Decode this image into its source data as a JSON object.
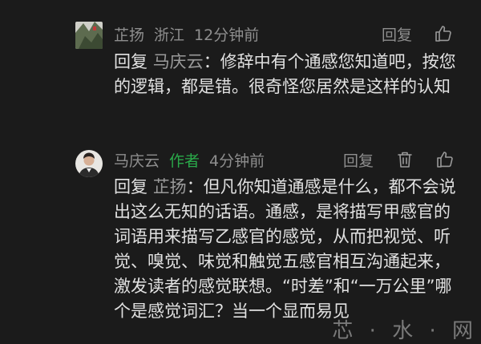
{
  "comments": [
    {
      "username": "芷扬",
      "location": "浙江",
      "time": "12分钟前",
      "reply_label": "回复",
      "text": {
        "prefix": "回复",
        "target": "马庆云",
        "content": "：修辞中有个通感您知道吧，按您的逻辑，都是错。很奇怪您居然是这样的认知"
      }
    },
    {
      "username": "马庆云",
      "author_tag": "作者",
      "time": "4分钟前",
      "reply_label": "回复",
      "text": {
        "prefix": "回复",
        "target": "芷扬",
        "content": "：但凡你知道通感是什么，都不会说出这么无知的话语。通感，是将描写甲感官的词语用来描写乙感官的感觉，从而把视觉、听觉、嗅觉、味觉和触觉五感官相互沟通起来，激发读者的感觉联想。“时差”和“一万公里”哪个是感觉词汇？当一个显而易见"
      }
    }
  ],
  "watermark": "芯 · 水 · 网",
  "colors": {
    "background": "#1b1b1b",
    "meta_text": "#8e8e8e",
    "body_text": "#e1e1e1",
    "author_tag": "#2aa94a"
  },
  "icons": {
    "like": "thumbs-up-icon",
    "delete": "trash-icon"
  }
}
